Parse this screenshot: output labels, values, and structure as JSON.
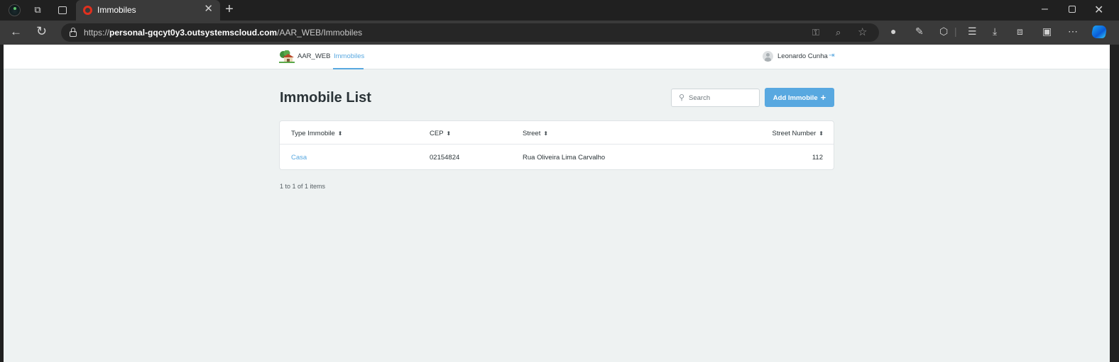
{
  "browser": {
    "tab": {
      "title": "Immobiles"
    },
    "url": {
      "scheme": "https://",
      "host": "personal-gqcyt0y3.outsystemscloud.com",
      "path": "/AAR_WEB/Immobiles"
    }
  },
  "header": {
    "app_name": "AAR_WEB",
    "nav": [
      {
        "label": "Immobiles",
        "active": true
      }
    ],
    "user": {
      "name": "Leonardo Cunha"
    }
  },
  "main": {
    "title": "Immobile List",
    "search": {
      "placeholder": "Search",
      "value": ""
    },
    "add_button": {
      "label": "Add Immobile",
      "icon": "plus-icon"
    },
    "table": {
      "columns": [
        "Type Immobile",
        "CEP",
        "Street",
        "Street Number"
      ],
      "rows": [
        {
          "type": "Casa",
          "cep": "02154824",
          "street": "Rua Oliveira Lima Carvalho",
          "number": "112"
        }
      ]
    },
    "pagination": {
      "info": "1 to 1 of 1 items"
    }
  },
  "colors": {
    "accent": "#58a8e0",
    "page_bg": "#eef2f2",
    "browser_dark": "#202020"
  }
}
